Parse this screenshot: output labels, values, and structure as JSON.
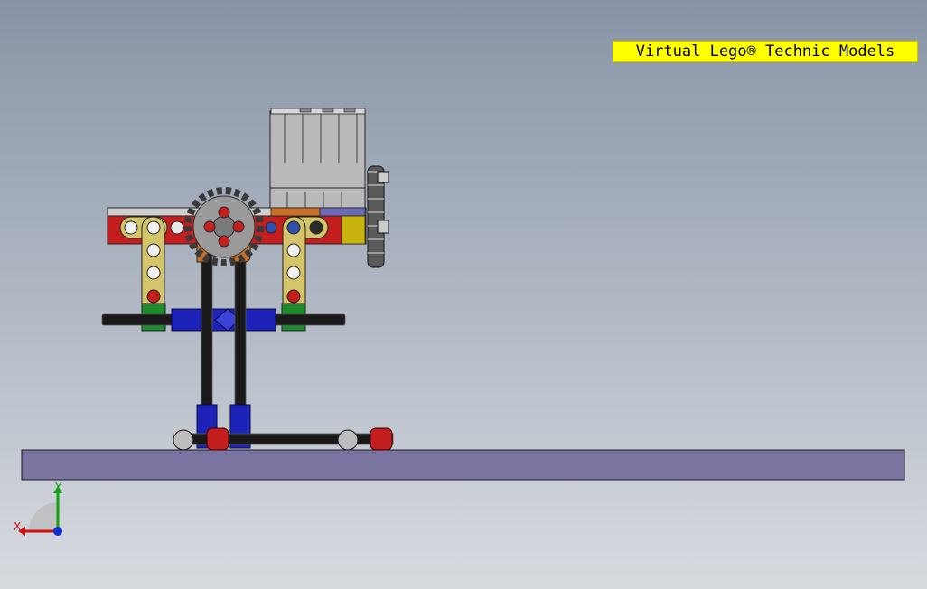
{
  "window": {
    "banner_text": "Virtual Lego® Technic Models"
  },
  "triad": {
    "x_label": "X",
    "y_label": "Y"
  },
  "colors": {
    "background_top": "#8894a6",
    "background_bottom": "#d7dbe0",
    "banner": "#ffff00",
    "ground_plate": "#7a74a0",
    "brick_red": "#c41e1e",
    "beam_yellow": "#d4c46a",
    "connector_green": "#1f8a2e",
    "axle_black": "#1a1a1a",
    "joint_blue": "#1d23b8",
    "motor_gray": "#b8b8b8",
    "gear_gray": "#8a8a8a",
    "accent_orange": "#c87028",
    "axis_x": "#d01010",
    "axis_y": "#10a010",
    "axis_z": "#1030d0"
  },
  "scene": {
    "model_name_icon": "lego-technic-walker-model-icon"
  }
}
